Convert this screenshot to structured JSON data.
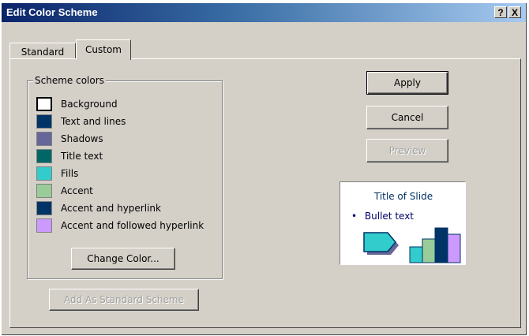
{
  "window": {
    "title": "Edit Color Scheme",
    "help_btn": "?",
    "close_btn": "X"
  },
  "tabs": [
    {
      "label": "Standard",
      "active": false
    },
    {
      "label": "Custom",
      "active": true
    }
  ],
  "scheme": {
    "group_label": "Scheme colors",
    "items": [
      {
        "label": "Background",
        "color": "#ffffff",
        "selected": true
      },
      {
        "label": "Text and lines",
        "color": "#003366"
      },
      {
        "label": "Shadows",
        "color": "#666699"
      },
      {
        "label": "Title text",
        "color": "#006666"
      },
      {
        "label": "Fills",
        "color": "#33cccc"
      },
      {
        "label": "Accent",
        "color": "#99cc99"
      },
      {
        "label": "Accent and hyperlink",
        "color": "#003366"
      },
      {
        "label": "Accent and followed hyperlink",
        "color": "#cc99ff"
      }
    ],
    "change_color": "Change Color..."
  },
  "add_scheme": "Add As Standard Scheme",
  "buttons": {
    "apply": "Apply",
    "cancel": "Cancel",
    "preview": "Preview"
  },
  "preview_box": {
    "title": "Title of Slide",
    "bullet": "Bullet text",
    "bullet_char": "•"
  }
}
